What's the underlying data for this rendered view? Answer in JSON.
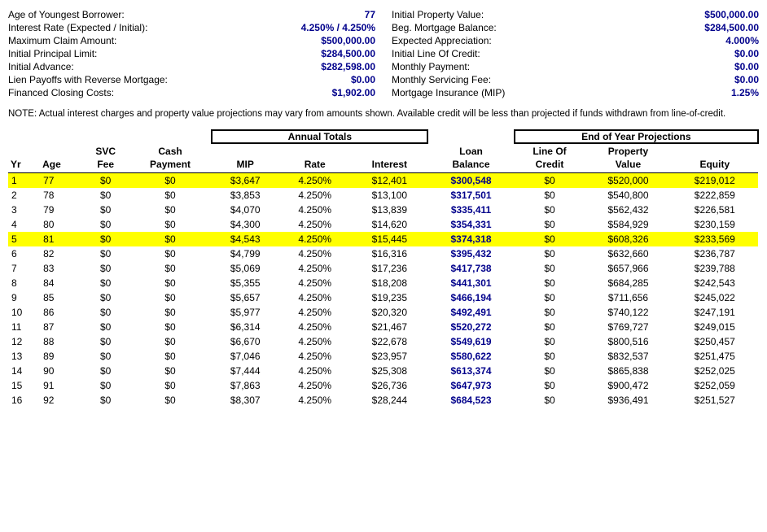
{
  "info_left": [
    {
      "label": "Age of Youngest Borrower:",
      "value": "77"
    },
    {
      "label": "Interest Rate (Expected / Initial):",
      "value": "4.250% / 4.250%"
    },
    {
      "label": "Maximum Claim Amount:",
      "value": "$500,000.00"
    },
    {
      "label": "Initial Principal Limit:",
      "value": "$284,500.00"
    },
    {
      "label": "Initial Advance:",
      "value": "$282,598.00"
    },
    {
      "label": "Lien Payoffs with Reverse Mortgage:",
      "value": "$0.00"
    },
    {
      "label": "Financed Closing Costs:",
      "value": "$1,902.00"
    }
  ],
  "info_right": [
    {
      "label": "Initial Property Value:",
      "value": "$500,000.00"
    },
    {
      "label": "Beg. Mortgage Balance:",
      "value": "$284,500.00"
    },
    {
      "label": "Expected Appreciation:",
      "value": "4.000%"
    },
    {
      "label": "Initial Line Of Credit:",
      "value": "$0.00"
    },
    {
      "label": "Monthly Payment:",
      "value": "$0.00"
    },
    {
      "label": "Monthly Servicing Fee:",
      "value": "$0.00"
    },
    {
      "label": "Mortgage Insurance (MIP)",
      "value": "1.25%"
    }
  ],
  "note": "NOTE: Actual interest charges and property value projections may vary from amounts shown. Available credit will be less than projected if funds withdrawn from line-of-credit.",
  "table": {
    "section1_label": "Annual Totals",
    "section2_label": "End of Year Projections",
    "columns": [
      "Yr",
      "Age",
      "SVC Fee",
      "Cash Payment",
      "MIP",
      "Rate",
      "Interest",
      "Loan Balance",
      "Line Of Credit",
      "Property Value",
      "Equity"
    ],
    "rows": [
      {
        "yr": 1,
        "age": 77,
        "svc": "$0",
        "cash": "$0",
        "mip": "$3,647",
        "rate": "4.250%",
        "interest": "$12,401",
        "loan": "$300,548",
        "loc": "$0",
        "prop": "$520,000",
        "equity": "$219,012",
        "highlight": true
      },
      {
        "yr": 2,
        "age": 78,
        "svc": "$0",
        "cash": "$0",
        "mip": "$3,853",
        "rate": "4.250%",
        "interest": "$13,100",
        "loan": "$317,501",
        "loc": "$0",
        "prop": "$540,800",
        "equity": "$222,859",
        "highlight": false
      },
      {
        "yr": 3,
        "age": 79,
        "svc": "$0",
        "cash": "$0",
        "mip": "$4,070",
        "rate": "4.250%",
        "interest": "$13,839",
        "loan": "$335,411",
        "loc": "$0",
        "prop": "$562,432",
        "equity": "$226,581",
        "highlight": false
      },
      {
        "yr": 4,
        "age": 80,
        "svc": "$0",
        "cash": "$0",
        "mip": "$4,300",
        "rate": "4.250%",
        "interest": "$14,620",
        "loan": "$354,331",
        "loc": "$0",
        "prop": "$584,929",
        "equity": "$230,159",
        "highlight": false
      },
      {
        "yr": 5,
        "age": 81,
        "svc": "$0",
        "cash": "$0",
        "mip": "$4,543",
        "rate": "4.250%",
        "interest": "$15,445",
        "loan": "$374,318",
        "loc": "$0",
        "prop": "$608,326",
        "equity": "$233,569",
        "highlight": true
      },
      {
        "yr": 6,
        "age": 82,
        "svc": "$0",
        "cash": "$0",
        "mip": "$4,799",
        "rate": "4.250%",
        "interest": "$16,316",
        "loan": "$395,432",
        "loc": "$0",
        "prop": "$632,660",
        "equity": "$236,787",
        "highlight": false
      },
      {
        "yr": 7,
        "age": 83,
        "svc": "$0",
        "cash": "$0",
        "mip": "$5,069",
        "rate": "4.250%",
        "interest": "$17,236",
        "loan": "$417,738",
        "loc": "$0",
        "prop": "$657,966",
        "equity": "$239,788",
        "highlight": false
      },
      {
        "yr": 8,
        "age": 84,
        "svc": "$0",
        "cash": "$0",
        "mip": "$5,355",
        "rate": "4.250%",
        "interest": "$18,208",
        "loan": "$441,301",
        "loc": "$0",
        "prop": "$684,285",
        "equity": "$242,543",
        "highlight": false
      },
      {
        "yr": 9,
        "age": 85,
        "svc": "$0",
        "cash": "$0",
        "mip": "$5,657",
        "rate": "4.250%",
        "interest": "$19,235",
        "loan": "$466,194",
        "loc": "$0",
        "prop": "$711,656",
        "equity": "$245,022",
        "highlight": false
      },
      {
        "yr": 10,
        "age": 86,
        "svc": "$0",
        "cash": "$0",
        "mip": "$5,977",
        "rate": "4.250%",
        "interest": "$20,320",
        "loan": "$492,491",
        "loc": "$0",
        "prop": "$740,122",
        "equity": "$247,191",
        "highlight": false
      },
      {
        "yr": 11,
        "age": 87,
        "svc": "$0",
        "cash": "$0",
        "mip": "$6,314",
        "rate": "4.250%",
        "interest": "$21,467",
        "loan": "$520,272",
        "loc": "$0",
        "prop": "$769,727",
        "equity": "$249,015",
        "highlight": false
      },
      {
        "yr": 12,
        "age": 88,
        "svc": "$0",
        "cash": "$0",
        "mip": "$6,670",
        "rate": "4.250%",
        "interest": "$22,678",
        "loan": "$549,619",
        "loc": "$0",
        "prop": "$800,516",
        "equity": "$250,457",
        "highlight": false
      },
      {
        "yr": 13,
        "age": 89,
        "svc": "$0",
        "cash": "$0",
        "mip": "$7,046",
        "rate": "4.250%",
        "interest": "$23,957",
        "loan": "$580,622",
        "loc": "$0",
        "prop": "$832,537",
        "equity": "$251,475",
        "highlight": false
      },
      {
        "yr": 14,
        "age": 90,
        "svc": "$0",
        "cash": "$0",
        "mip": "$7,444",
        "rate": "4.250%",
        "interest": "$25,308",
        "loan": "$613,374",
        "loc": "$0",
        "prop": "$865,838",
        "equity": "$252,025",
        "highlight": false
      },
      {
        "yr": 15,
        "age": 91,
        "svc": "$0",
        "cash": "$0",
        "mip": "$7,863",
        "rate": "4.250%",
        "interest": "$26,736",
        "loan": "$647,973",
        "loc": "$0",
        "prop": "$900,472",
        "equity": "$252,059",
        "highlight": false
      },
      {
        "yr": 16,
        "age": 92,
        "svc": "$0",
        "cash": "$0",
        "mip": "$8,307",
        "rate": "4.250%",
        "interest": "$28,244",
        "loan": "$684,523",
        "loc": "$0",
        "prop": "$936,491",
        "equity": "$251,527",
        "highlight": false
      }
    ]
  }
}
